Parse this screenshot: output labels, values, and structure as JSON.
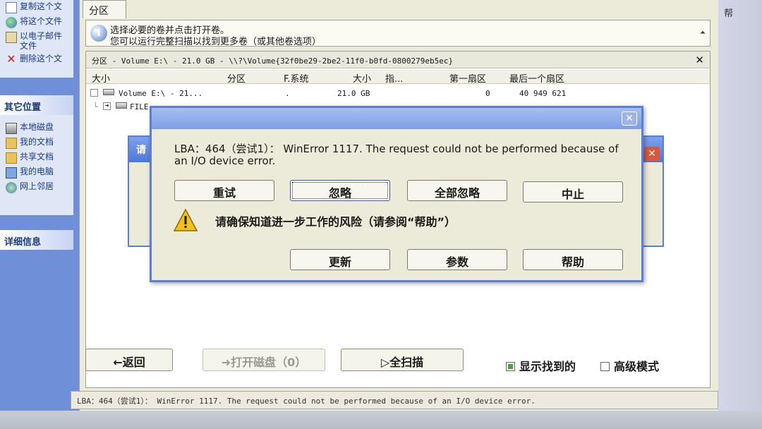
{
  "taskpane": {
    "file_tasks": [
      {
        "label": "复制这个文",
        "icon": "copy-icon"
      },
      {
        "label": "将这个文件",
        "icon": "globe-icon"
      },
      {
        "label": "以电子邮件",
        "label2": "文件",
        "icon": "mail-icon"
      },
      {
        "label": "删除这个文",
        "icon": "delete-icon"
      }
    ],
    "other_places_title": "其它位置",
    "other_places": [
      {
        "label": "本地磁盘",
        "icon": "drive-icon"
      },
      {
        "label": "我的文档",
        "icon": "my-documents-icon"
      },
      {
        "label": "共享文档",
        "icon": "shared-folder-icon"
      },
      {
        "label": "我的电脑",
        "icon": "my-computer-icon"
      },
      {
        "label": "网上邻居",
        "icon": "network-icon"
      }
    ],
    "details_title": "详细信息"
  },
  "menu": {
    "help": "帮"
  },
  "main": {
    "tab_label": "分区",
    "info": {
      "line1": "选择必要的卷并点击打开卷。",
      "line2": "您可以运行完整扫描以找到更多卷（或其他卷选项）"
    },
    "volume_title": "分区 - Volume E:\\ - 21.0 GB - \\\\?\\Volume{32f0be29-2be2-11f0-b0fd-0800279eb5ec}",
    "columns": [
      "大小",
      "分区",
      "F.系统",
      "大小",
      "指...",
      "第一扇区",
      "最后一个扇区"
    ],
    "rows": [
      {
        "name": "Volume E:\\ - 21...",
        "fs": ".",
        "size": "21.0 GB",
        "first": "0",
        "last": "40 949 621"
      },
      {
        "name": "FILE"
      }
    ]
  },
  "buttons": {
    "back": "←返回",
    "open_disk": "➜打开磁盘（0）",
    "full_scan": "▷全扫描",
    "show_found": "显示找到的",
    "advanced": "高级模式"
  },
  "status_text": "LBA：464（尝试1）： WinError 1117. The request could not be performed because of an I/O device error.",
  "bg_dialog": {
    "title": "请"
  },
  "error_dialog": {
    "message": "LBA：464（尝试1）：  WinError 1117. The request could not be performed because of an I/O device error.",
    "retry": "重试",
    "ignore": "忽略",
    "ignore_all": "全部忽略",
    "abort": "中止",
    "warning": "请确保知道进一步工作的风险（请参阅“帮助”）",
    "update": "更新",
    "params": "参数",
    "help": "帮助"
  },
  "colors": {
    "titlebar": "#7d9ee6",
    "dialog_bg": "#ecead8",
    "taskpane": "#6f8fd8"
  }
}
